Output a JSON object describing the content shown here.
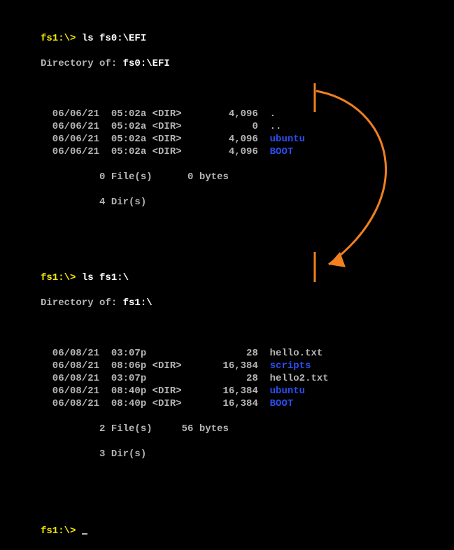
{
  "colors": {
    "yellow": "#f5e900",
    "white": "#ffffff",
    "grey": "#b5b5b5",
    "blue": "#2b4ef0",
    "arrow": "#f08020"
  },
  "block1": {
    "prompt": "fs1:\\> ",
    "cmd": "ls fs0:\\EFI",
    "dirlabel": "Directory of: ",
    "dirpath": "fs0:\\EFI",
    "rows": [
      {
        "date": "06/06/21",
        "time": "05:02a",
        "dir": "<DIR>",
        "size": "4,096",
        "name": ".",
        "cls": "g"
      },
      {
        "date": "06/06/21",
        "time": "05:02a",
        "dir": "<DIR>",
        "size": "0",
        "name": "..",
        "cls": "g"
      },
      {
        "date": "06/06/21",
        "time": "05:02a",
        "dir": "<DIR>",
        "size": "4,096",
        "name": "ubuntu",
        "cls": "b"
      },
      {
        "date": "06/06/21",
        "time": "05:02a",
        "dir": "<DIR>",
        "size": "4,096",
        "name": "BOOT",
        "cls": "b"
      }
    ],
    "sum_files": "          0 File(s)",
    "sum_bytes": "      0 bytes",
    "sum_dirs": "          4 Dir(s)"
  },
  "block2": {
    "prompt": "fs1:\\> ",
    "cmd": "ls fs1:\\",
    "dirlabel": "Directory of: ",
    "dirpath": "fs1:\\",
    "rows": [
      {
        "date": "06/08/21",
        "time": "03:07p",
        "dir": "     ",
        "size": "28",
        "name": "hello.txt",
        "cls": "g"
      },
      {
        "date": "06/08/21",
        "time": "08:06p",
        "dir": "<DIR>",
        "size": "16,384",
        "name": "scripts",
        "cls": "b"
      },
      {
        "date": "06/08/21",
        "time": "03:07p",
        "dir": "     ",
        "size": "28",
        "name": "hello2.txt",
        "cls": "g"
      },
      {
        "date": "06/08/21",
        "time": "08:40p",
        "dir": "<DIR>",
        "size": "16,384",
        "name": "ubuntu",
        "cls": "b"
      },
      {
        "date": "06/08/21",
        "time": "08:40p",
        "dir": "<DIR>",
        "size": "16,384",
        "name": "BOOT",
        "cls": "b"
      }
    ],
    "sum_files": "          2 File(s)",
    "sum_bytes": "     56 bytes",
    "sum_dirs": "          3 Dir(s)"
  },
  "final_prompt": "fs1:\\> "
}
